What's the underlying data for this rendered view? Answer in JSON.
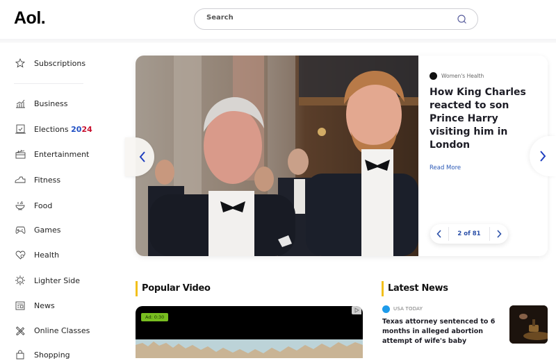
{
  "header": {
    "logo": "Aol.",
    "search_placeholder": "Search"
  },
  "sidebar": {
    "subscriptions": {
      "label": "Subscriptions",
      "icon": "star-icon"
    },
    "items": [
      {
        "label": "Business",
        "icon": "chart-growth-icon"
      },
      {
        "label": "Elections",
        "year_part1": "20",
        "year_part2": "24",
        "icon": "ballot-box-icon"
      },
      {
        "label": "Entertainment",
        "icon": "clapperboard-icon"
      },
      {
        "label": "Fitness",
        "icon": "sneaker-icon"
      },
      {
        "label": "Food",
        "icon": "bowl-icon"
      },
      {
        "label": "Games",
        "icon": "gamepad-icon"
      },
      {
        "label": "Health",
        "icon": "heart-icon"
      },
      {
        "label": "Lighter Side",
        "icon": "sun-icon"
      },
      {
        "label": "News",
        "icon": "newspaper-icon"
      },
      {
        "label": "Online Classes",
        "icon": "pencil-ruler-icon"
      },
      {
        "label": "Shopping",
        "icon": "shopping-bag-icon"
      }
    ]
  },
  "hero": {
    "source": "Women's Health",
    "title": "How King Charles reacted to son Prince Harry visiting him in London",
    "read_more": "Read More",
    "pager": "2 of 81",
    "current": 2,
    "total": 81
  },
  "popular_video": {
    "title": "Popular Video",
    "ad_badge": "Ad: 0:30"
  },
  "latest_news": {
    "title": "Latest News",
    "items": [
      {
        "source": "USA TODAY",
        "title": "Texas attorney sentenced to 6 months in alleged abortion attempt of wife's baby"
      }
    ]
  },
  "colors": {
    "accent_blue": "#2a58b6",
    "section_bar": "#f2c01b",
    "elections_blue": "#1f4fc4",
    "elections_red": "#c8102e",
    "ad_green": "#78be20"
  }
}
